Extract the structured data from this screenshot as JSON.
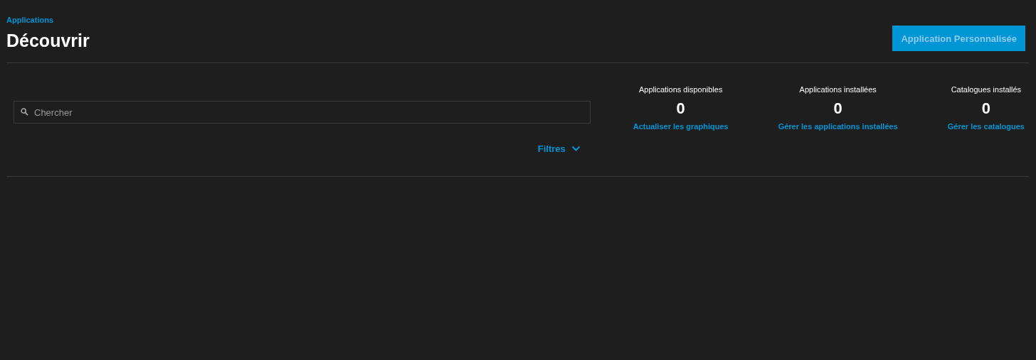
{
  "breadcrumb": "Applications",
  "title": "Découvrir",
  "action_button": {
    "label": "Application Personnalisée",
    "disabled": true
  },
  "search": {
    "placeholder": "Chercher"
  },
  "filters": {
    "label": "Filtres",
    "expanded": false
  },
  "stats": [
    {
      "label": "Applications disponibles",
      "value": "0",
      "link": "Actualiser les graphiques"
    },
    {
      "label": "Applications installées",
      "value": "0",
      "link": "Gérer les applications installées"
    },
    {
      "label": "Catalogues installés",
      "value": "0",
      "link": "Gérer les catalogues"
    }
  ]
}
